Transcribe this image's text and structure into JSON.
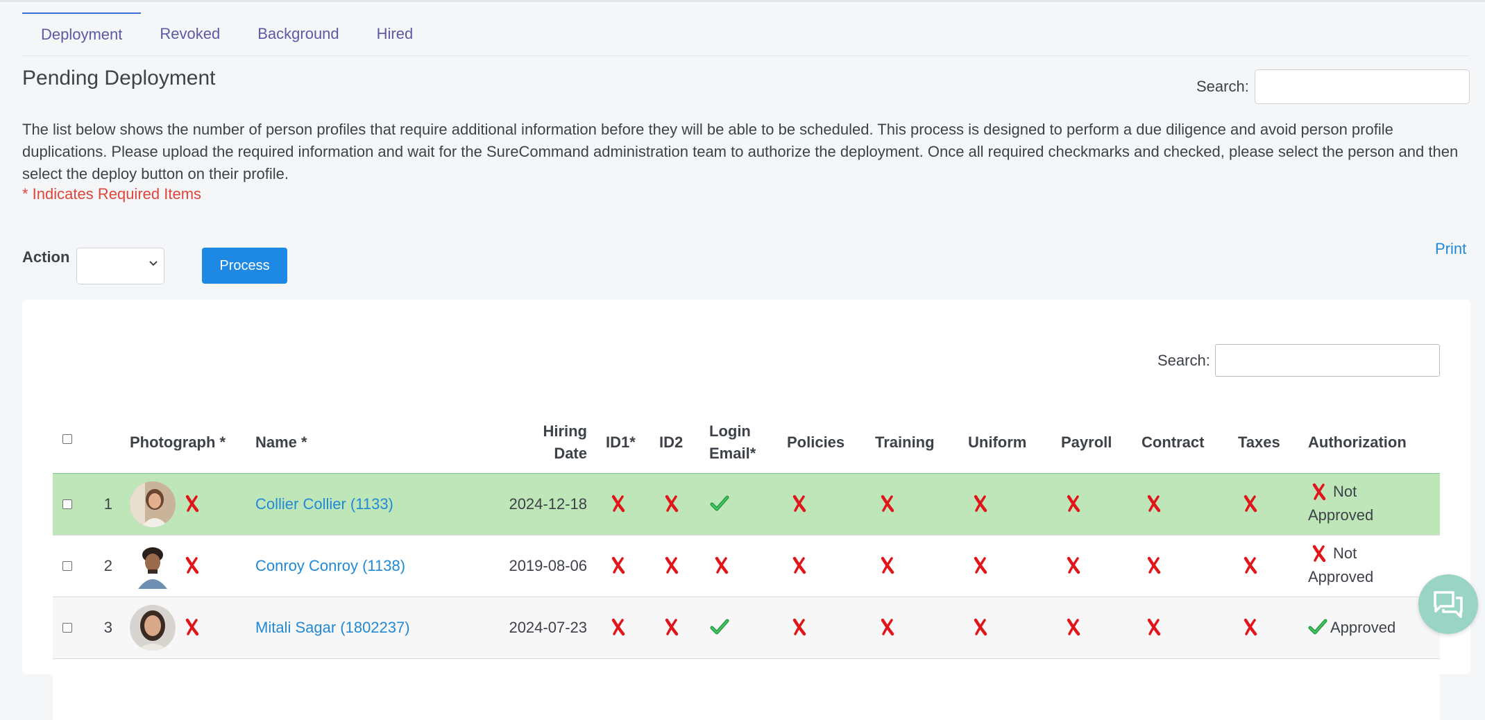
{
  "tabs": [
    {
      "label": "Deployment",
      "active": true
    },
    {
      "label": "Revoked",
      "active": false
    },
    {
      "label": "Background",
      "active": false
    },
    {
      "label": "Hired",
      "active": false
    }
  ],
  "page": {
    "title": "Pending Deployment",
    "search_label": "Search:",
    "description": "The list below shows the number of person profiles that require additional information before they will be able to be scheduled. This process is designed to perform a due diligence and avoid person profile duplications. Please upload the required information and wait for the SureCommand administration team to authorize the deployment. Once all required checkmarks and checked, please select the person and then select the deploy button on their profile.",
    "required_note": "* Indicates Required Items"
  },
  "actions": {
    "action_label": "Action",
    "action_value": "",
    "process_label": "Process",
    "print_label": "Print"
  },
  "table": {
    "search_label": "Search:",
    "headers": {
      "photograph": "Photograph *",
      "name": "Name *",
      "hiring_date_line1": "Hiring",
      "hiring_date_line2": "Date",
      "id1": "ID1*",
      "id2": "ID2",
      "login_email_line1": "Login",
      "login_email_line2": "Email*",
      "policies": "Policies",
      "training": "Training",
      "uniform": "Uniform",
      "payroll": "Payroll",
      "contract": "Contract",
      "taxes": "Taxes",
      "authorization": "Authorization"
    },
    "rows": [
      {
        "num": "1",
        "name": "Collier Collier (1133)",
        "hiring_date": "2024-12-18",
        "photo_ok": false,
        "id1": false,
        "id2": false,
        "login_email": true,
        "policies": false,
        "training": false,
        "uniform": false,
        "payroll": false,
        "contract": false,
        "taxes": false,
        "authorized": false,
        "auth_line1": "Not",
        "auth_line2": "Approved",
        "highlight": true
      },
      {
        "num": "2",
        "name": "Conroy Conroy (1138)",
        "hiring_date": "2019-08-06",
        "photo_ok": false,
        "id1": false,
        "id2": false,
        "login_email": false,
        "policies": false,
        "training": false,
        "uniform": false,
        "payroll": false,
        "contract": false,
        "taxes": false,
        "authorized": false,
        "auth_line1": "Not",
        "auth_line2": "Approved",
        "highlight": false
      },
      {
        "num": "3",
        "name": "Mitali Sagar (1802237)",
        "hiring_date": "2024-07-23",
        "photo_ok": false,
        "id1": false,
        "id2": false,
        "login_email": true,
        "policies": false,
        "training": false,
        "uniform": false,
        "payroll": false,
        "contract": false,
        "taxes": false,
        "authorized": true,
        "auth_line1": "Approved",
        "auth_line2": "",
        "highlight": false
      }
    ]
  },
  "icons": {
    "x_mark": "red-x-icon",
    "check_mark": "green-check-icon",
    "chat": "chat-bubble-icon"
  },
  "colors": {
    "tab_text": "#5a5aa6",
    "link": "#2189d6",
    "primary_button": "#1e88e5",
    "required_note": "#e0453a",
    "highlight_row": "#bfe6b8",
    "x_mark": "#e0161b",
    "check_mark": "#1e9a3c",
    "chat_button": "#9ad4c4"
  }
}
